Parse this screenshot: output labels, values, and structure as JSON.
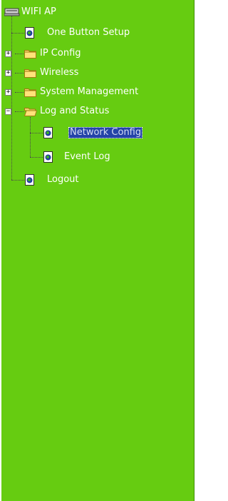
{
  "tree": {
    "root": {
      "label": "WIFI AP",
      "icon": "computer-icon"
    },
    "items": [
      {
        "label": "One Button Setup",
        "icon": "page-icon",
        "type": "page"
      },
      {
        "label": "IP Config",
        "icon": "folder-icon",
        "type": "folder",
        "expanded": false
      },
      {
        "label": "Wireless",
        "icon": "folder-icon",
        "type": "folder",
        "expanded": false
      },
      {
        "label": "System Management",
        "icon": "folder-icon",
        "type": "folder",
        "expanded": false
      },
      {
        "label": "Log and Status",
        "icon": "folder-open-icon",
        "type": "folder",
        "expanded": true,
        "children": [
          {
            "label": "Network Config",
            "icon": "page-icon",
            "selected": true
          },
          {
            "label": "Event Log",
            "icon": "page-icon",
            "selected": false
          }
        ]
      },
      {
        "label": "Logout",
        "icon": "page-icon",
        "type": "page"
      }
    ],
    "expander_collapsed": "+",
    "expander_expanded": "−"
  },
  "colors": {
    "panel_background": "#66cc11",
    "selection_background": "#2443a8",
    "text": "#ffffff"
  }
}
